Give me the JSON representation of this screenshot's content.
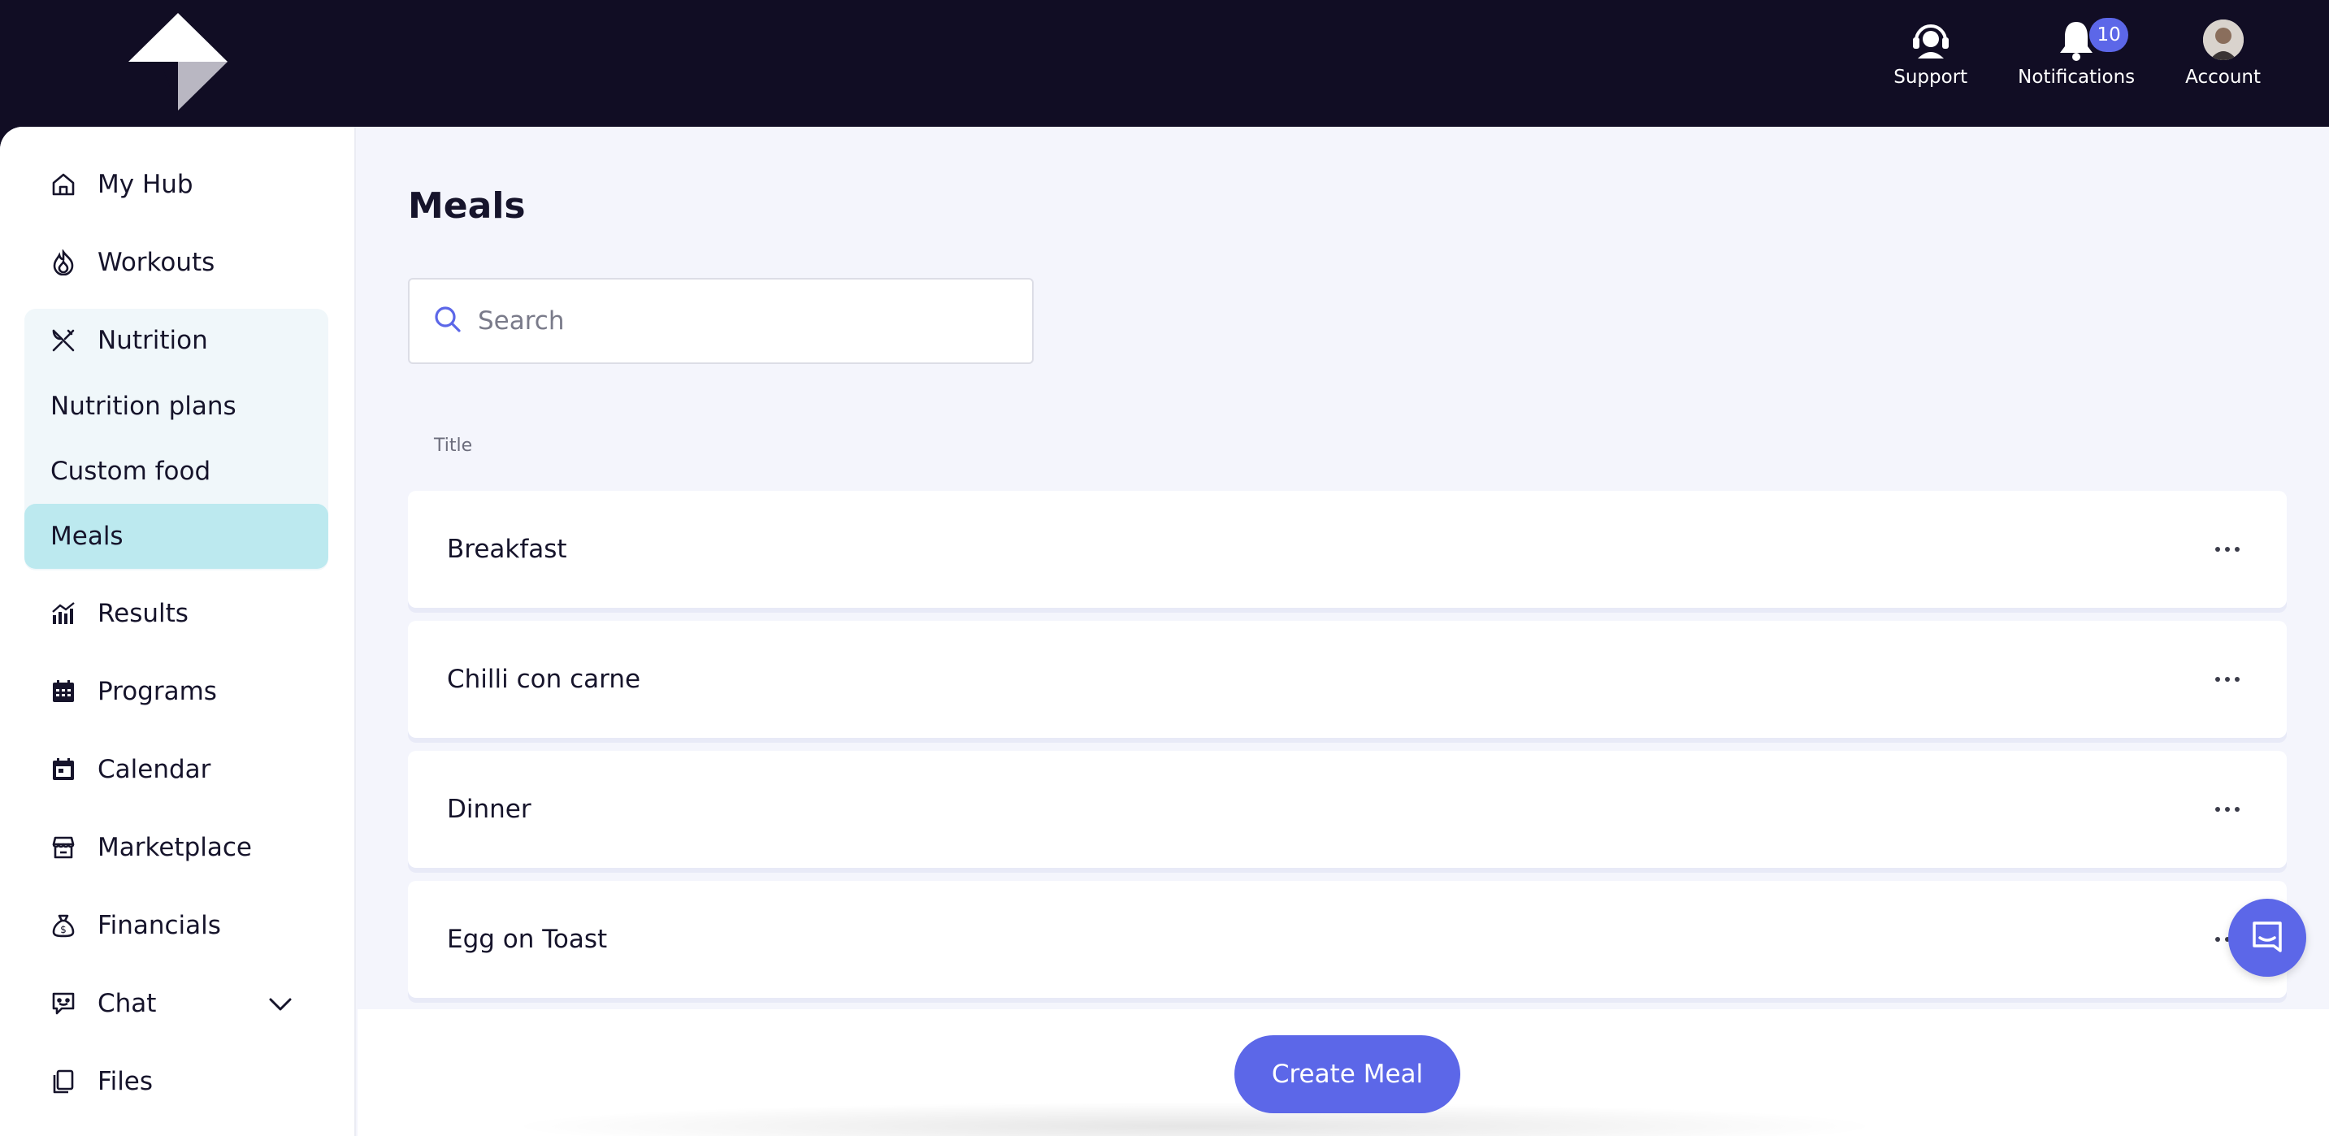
{
  "header": {
    "support_label": "Support",
    "notifications_label": "Notifications",
    "notifications_count": "10",
    "account_label": "Account"
  },
  "sidebar": {
    "items": [
      {
        "label": "My Hub",
        "icon": "home-icon"
      },
      {
        "label": "Workouts",
        "icon": "flame-icon"
      },
      {
        "label": "Nutrition",
        "icon": "fork-knife-icon"
      },
      {
        "label": "Results",
        "icon": "chart-icon"
      },
      {
        "label": "Programs",
        "icon": "calendar-grid-icon"
      },
      {
        "label": "Calendar",
        "icon": "calendar-icon"
      },
      {
        "label": "Marketplace",
        "icon": "store-icon"
      },
      {
        "label": "Financials",
        "icon": "money-bag-icon"
      },
      {
        "label": "Chat",
        "icon": "chat-icon"
      },
      {
        "label": "Files",
        "icon": "files-icon"
      }
    ],
    "nutrition_sub": [
      {
        "label": "Nutrition plans"
      },
      {
        "label": "Custom food"
      },
      {
        "label": "Meals",
        "active": true
      }
    ]
  },
  "main": {
    "title": "Meals",
    "search_placeholder": "Search",
    "column_title": "Title",
    "rows": [
      "Breakfast",
      "Chilli con carne",
      "Dinner",
      "Egg on Toast"
    ],
    "create_button": "Create Meal"
  },
  "colors": {
    "header_bg": "#110d24",
    "accent": "#5c67e8",
    "active_nav": "#bce9ef",
    "page_bg": "#f4f5fc"
  }
}
